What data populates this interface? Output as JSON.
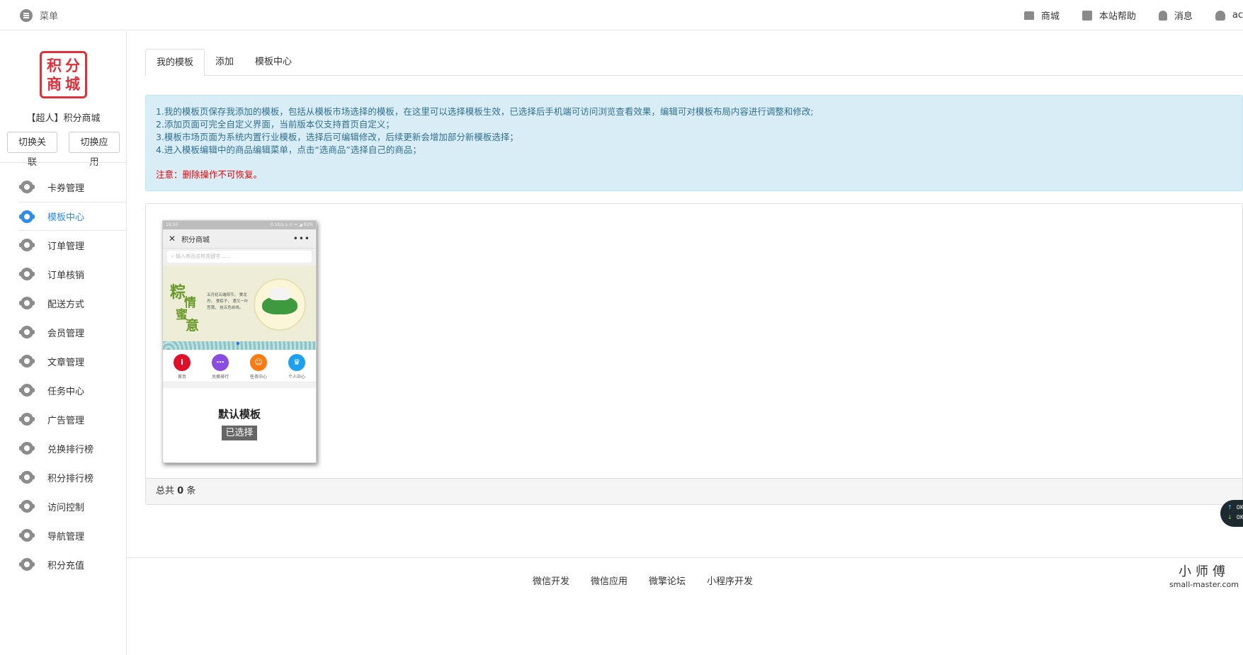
{
  "topbar": {
    "menu_label": "菜单",
    "links": [
      {
        "label": "商城",
        "icon": "store-icon"
      },
      {
        "label": "本站帮助",
        "icon": "help-icon"
      },
      {
        "label": "消息",
        "icon": "bell-icon"
      },
      {
        "label": "ac",
        "icon": "user-icon"
      }
    ]
  },
  "sidebar": {
    "logo_chars": [
      "积",
      "分",
      "商",
      "城"
    ],
    "account_name": "【超人】积分商城",
    "switch_link_label": "切换关联",
    "switch_app_label": "切换应用",
    "items": [
      {
        "label": "卡券管理",
        "active": false
      },
      {
        "label": "模板中心",
        "active": true
      },
      {
        "label": "订单管理",
        "active": false
      },
      {
        "label": "订单核销",
        "active": false
      },
      {
        "label": "配送方式",
        "active": false
      },
      {
        "label": "会员管理",
        "active": false
      },
      {
        "label": "文章管理",
        "active": false
      },
      {
        "label": "任务中心",
        "active": false
      },
      {
        "label": "广告管理",
        "active": false
      },
      {
        "label": "兑换排行榜",
        "active": false
      },
      {
        "label": "积分排行榜",
        "active": false
      },
      {
        "label": "访问控制",
        "active": false
      },
      {
        "label": "导航管理",
        "active": false
      },
      {
        "label": "积分充值",
        "active": false
      }
    ]
  },
  "tabs": [
    {
      "label": "我的模板",
      "active": true
    },
    {
      "label": "添加",
      "active": false
    },
    {
      "label": "模板中心",
      "active": false
    }
  ],
  "notice": {
    "lines": [
      "1.我的模板页保存我添加的模板，包括从模板市场选择的模板，在这里可以选择模板生效，已选择后手机端可访问浏览查看效果，编辑可对模板布局内容进行调整和修改;",
      "2.添加页面可完全自定义界面，当前版本仅支持首页自定义；",
      "3.模板市场页面为系统内置行业模板，选择后可编辑修改，后续更新会增加部分新模板选择；",
      "4.进入模板编辑中的商品编辑菜单，点击“选商品”选择自己的商品；"
    ],
    "warning": "注意：删除操作不可恢复。"
  },
  "template": {
    "phone_status_left": "16:50",
    "phone_status_right": "0.1K/s ⌂ ⊙ ≈ ◢ 82%",
    "phone_title": "积分商城",
    "phone_search_placeholder": "输入商品名称关键字......",
    "banner": {
      "big1": "粽",
      "big2": "情",
      "big3": "蜜",
      "big4": "意",
      "poem": "五月初五端阳节， 赛龙舟， 食粽子， 惠又一叶莒蒲， 挂五色丝线。"
    },
    "icons": [
      {
        "label": "首页",
        "glyph": "i",
        "color": "#e0102a"
      },
      {
        "label": "兑换排行",
        "glyph": "⋯",
        "color": "#8a4de0"
      },
      {
        "label": "任务中心",
        "glyph": "☺",
        "color": "#ff7a10"
      },
      {
        "label": "个人中心",
        "glyph": "♛",
        "color": "#1ea0f0"
      }
    ],
    "name": "默认模板",
    "status": "已选择"
  },
  "panel_footer": {
    "prefix": "总共",
    "count": "0",
    "suffix": "条"
  },
  "footer": {
    "links": [
      "微信开发",
      "微信应用",
      "微擎论坛",
      "小程序开发"
    ]
  },
  "watermark": {
    "big": "小师傅",
    "small": "small-master.com"
  },
  "netspeed": {
    "up": "0K/s",
    "down": "0K/s"
  }
}
